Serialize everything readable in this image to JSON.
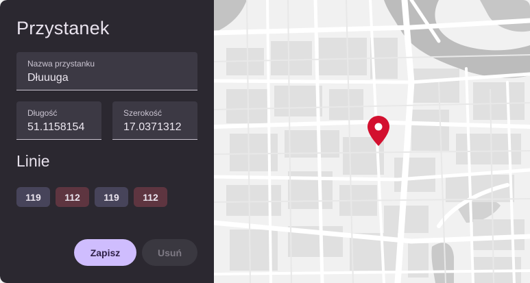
{
  "panel": {
    "title": "Przystanek",
    "fields": {
      "name": {
        "label": "Nazwa przystanku",
        "value": "Dłuuuga"
      },
      "longitude": {
        "label": "Długość",
        "value": "51.1158154"
      },
      "latitude": {
        "label": "Szerokość",
        "value": "17.0371312"
      }
    },
    "lines_heading": "Linie",
    "lines": [
      "119",
      "112",
      "119",
      "112"
    ],
    "buttons": {
      "save": "Zapisz",
      "delete": "Usuń"
    }
  },
  "colors": {
    "panel_bg": "#2b2830",
    "accent": "#cfbdfe",
    "chip_neutral": "#47445a",
    "chip_red": "#5e3540",
    "marker": "#d3102f"
  },
  "map": {
    "marker_icon": "map-pin-icon"
  }
}
